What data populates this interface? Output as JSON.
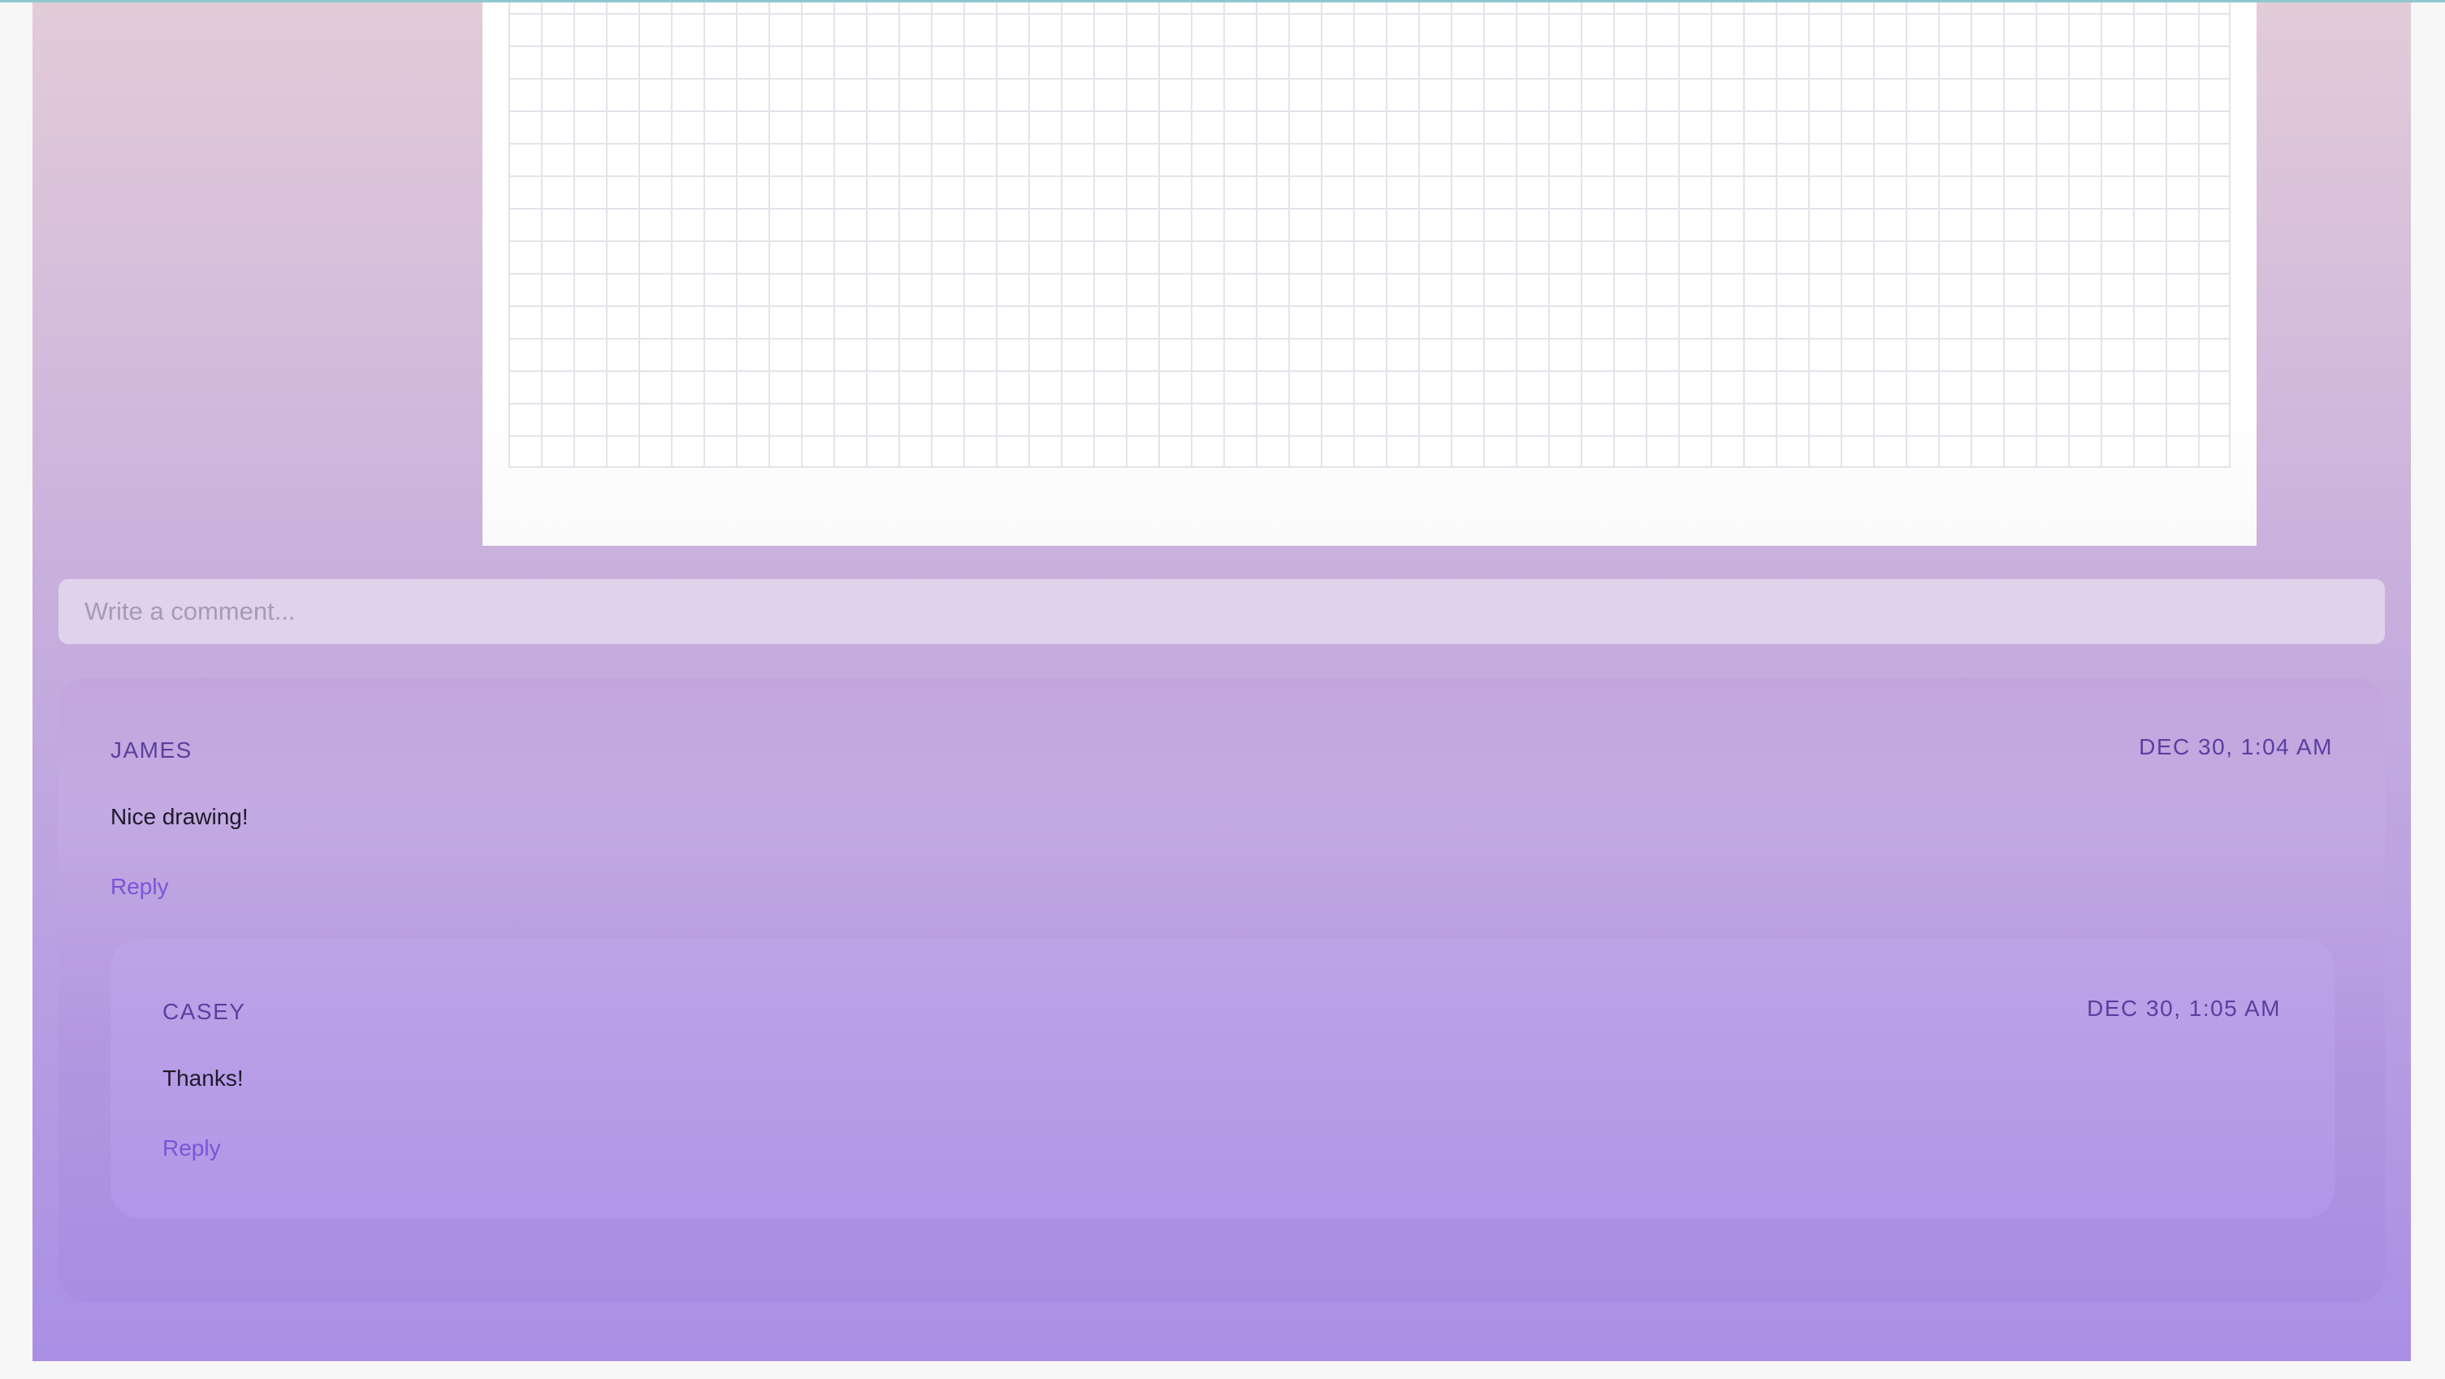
{
  "comment_box": {
    "placeholder": "Write a comment..."
  },
  "comments": [
    {
      "author": "JAMES",
      "timestamp": "DEC 30, 1:04 AM",
      "body": "Nice drawing!",
      "reply_label": "Reply",
      "replies": [
        {
          "author": "CASEY",
          "timestamp": "DEC 30, 1:05 AM",
          "body": "Thanks!",
          "reply_label": "Reply"
        }
      ]
    }
  ],
  "colors": {
    "accent": "#7a55d6",
    "author": "#5a3fa0",
    "gradient_top": "#e3ccd8",
    "gradient_bottom": "#aa8fe4"
  }
}
